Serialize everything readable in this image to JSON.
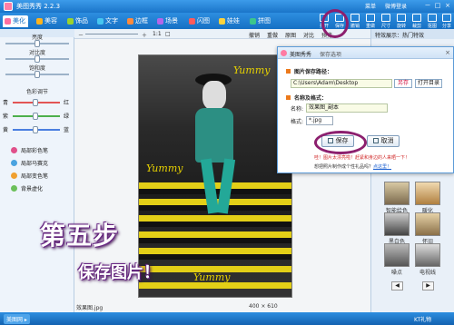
{
  "app": {
    "title": "美图秀秀 2.2.3",
    "links": [
      "菜单",
      "微博登录"
    ],
    "window_buttons": [
      "－",
      "□",
      "×"
    ]
  },
  "tabs": [
    {
      "label": "美化",
      "color": "#ff6fa0"
    },
    {
      "label": "美容",
      "color": "#ffb31c"
    },
    {
      "label": "饰品",
      "color": "#9bd22e"
    },
    {
      "label": "文字",
      "color": "#46c6f0"
    },
    {
      "label": "边框",
      "color": "#ff8a3c"
    },
    {
      "label": "场景",
      "color": "#b466e8"
    },
    {
      "label": "闪图",
      "color": "#ff5b5b"
    },
    {
      "label": "娃娃",
      "color": "#ffd33c"
    },
    {
      "label": "拼图",
      "color": "#3cc68c"
    }
  ],
  "tools": [
    "打开",
    "保存",
    "撤销",
    "重做",
    "尺寸",
    "旋转",
    "裁剪",
    "抠图",
    "分享"
  ],
  "left_panel": {
    "sliders": [
      {
        "label": "亮度",
        "level": 0.5
      },
      {
        "label": "对比度",
        "level": 0.5
      },
      {
        "label": "饱和度",
        "level": 0.5
      }
    ],
    "color_title": "色彩调节",
    "color_rows": [
      {
        "left": "青",
        "right": "红",
        "color": "#e25555"
      },
      {
        "left": "紫",
        "right": "绿",
        "color": "#4cb04c"
      },
      {
        "left": "黄",
        "right": "蓝",
        "color": "#4a7ee0"
      }
    ],
    "effects": [
      {
        "label": "局部彩色笔",
        "color": "#e0508a"
      },
      {
        "label": "局部马赛克",
        "color": "#4aa3e0"
      },
      {
        "label": "局部变色笔",
        "color": "#f0a030"
      },
      {
        "label": "背景虚化",
        "color": "#6cc05a"
      }
    ]
  },
  "canvas": {
    "zoom_controls": [
      "－",
      "＋",
      "1:1",
      "□"
    ],
    "actions": [
      "撤销",
      "重做",
      "原图",
      "对比",
      "预览"
    ],
    "photo_text": [
      "Yummy",
      "Yummy",
      "Yummy"
    ],
    "filename": "效果图.jpg",
    "dimensions": "400 × 610"
  },
  "right_panel": {
    "header": "特效展示：热门特效",
    "effects": [
      "智能绘色",
      "暖化",
      "黑白色",
      "怀旧",
      "噪点",
      "电视线"
    ],
    "pager": [
      "◀",
      "▶"
    ]
  },
  "dialog": {
    "title": "美图秀秀",
    "subtitle": "保存选项",
    "close": "×",
    "path_section": "图片保存路径：",
    "path_value": "C:\\Users\\Adam\\Desktop",
    "saveas_label": "另存",
    "open_dir_label": "打开目录",
    "name_section": "名称及格式：",
    "name_label": "名称:",
    "name_value": "效果图_副本",
    "format_label": "格式:",
    "format_value": "*.jpg",
    "save_label": "保存",
    "cancel_label": "取消",
    "note1": "哇！图片太漂亮啦！赶紧和身边的人来晒一下！",
    "note2_prefix": "想把照片制作成个性礼品吗？",
    "note2_link": "点这里！"
  },
  "overlay": {
    "step_title": "第五步",
    "step_desc": "保存图片！"
  },
  "taskbar": {
    "app_label": "美图网 ▸",
    "right_label": "KT礼物"
  }
}
